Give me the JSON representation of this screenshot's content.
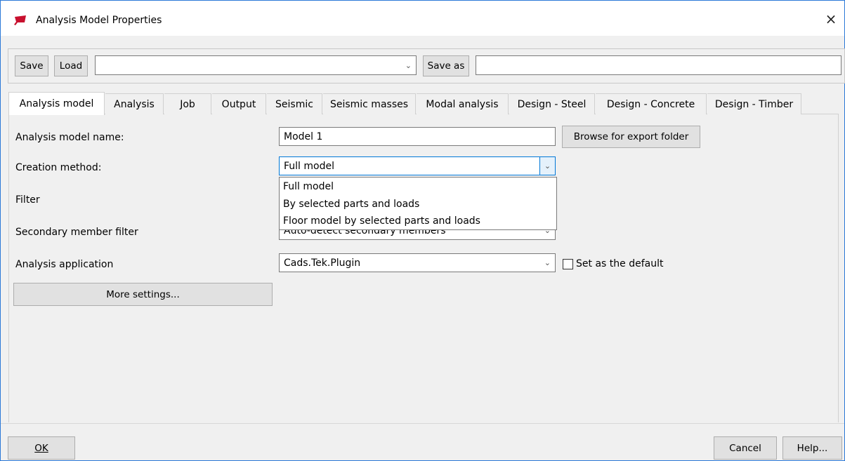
{
  "window": {
    "title": "Analysis Model Properties",
    "close_glyph": "×",
    "accent": "#2b79d8"
  },
  "toolbar": {
    "save_label": "Save",
    "load_label": "Load",
    "preset_value": "",
    "save_as_label": "Save as",
    "save_as_value": ""
  },
  "tabs": [
    {
      "label": "Analysis model",
      "active": true
    },
    {
      "label": "Analysis"
    },
    {
      "label": "Job"
    },
    {
      "label": "Output"
    },
    {
      "label": "Seismic"
    },
    {
      "label": "Seismic masses"
    },
    {
      "label": "Modal analysis"
    },
    {
      "label": "Design - Steel"
    },
    {
      "label": "Design - Concrete"
    },
    {
      "label": "Design - Timber"
    }
  ],
  "form": {
    "model_name_label": "Analysis model name:",
    "model_name_value": "Model 1",
    "browse_label": "Browse for export folder",
    "creation_label": "Creation method:",
    "creation_value": "Full model",
    "creation_options": [
      "Full model",
      "By selected parts and loads",
      "Floor model by selected parts and loads"
    ],
    "filter_label": "Filter",
    "secondary_label": "Secondary member filter",
    "secondary_value": "Auto-detect secondary members",
    "application_label": "Analysis application",
    "application_value": "Cads.Tek.Plugin",
    "default_checkbox_label": "Set as the default",
    "default_checked": false,
    "more_settings_label": "More settings..."
  },
  "footer": {
    "ok_label": "OK",
    "cancel_label": "Cancel",
    "help_label": "Help..."
  },
  "icons": {
    "dropdown": "chevron-down-icon",
    "app": "tekla-app-icon",
    "close": "close-icon"
  }
}
